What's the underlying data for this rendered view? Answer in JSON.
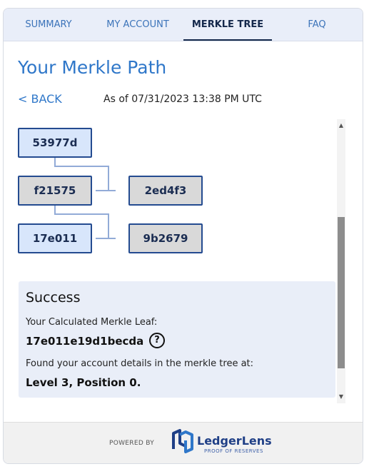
{
  "tabs": [
    {
      "label": "SUMMARY"
    },
    {
      "label": "MY ACCOUNT"
    },
    {
      "label": "MERKLE TREE"
    },
    {
      "label": "FAQ"
    }
  ],
  "active_tab": "MERKLE TREE",
  "page": {
    "title": "Your Merkle Path",
    "back_label": "< BACK",
    "as_of": "As of 07/31/2023 13:38 PM UTC"
  },
  "tree": {
    "root": "53977d",
    "level2_left": "f21575",
    "level2_right": "2ed4f3",
    "level3_left": "17e011",
    "level3_right": "9b2679"
  },
  "success": {
    "title": "Success",
    "calc_label": "Your Calculated Merkle Leaf:",
    "leaf_value": "17e011e19d1becda",
    "help_symbol": "?",
    "found_label": "Found your account details in the merkle tree at:",
    "position_value": "Level 3, Position 0."
  },
  "scrollbar": {
    "up_arrow": "▲",
    "down_arrow": "▼"
  },
  "footer": {
    "powered_by": "POWERED BY",
    "brand": "LedgerLens",
    "subbrand": "PROOF OF RESERVES"
  },
  "colors": {
    "accent": "#2f77c9",
    "node_border": "#244b90",
    "node_blue": "#d8e6fb",
    "node_grey": "#d9d9d9",
    "connector": "#92abd7",
    "success_bg": "#e9eef8",
    "tab_bar": "#e9eef9"
  }
}
